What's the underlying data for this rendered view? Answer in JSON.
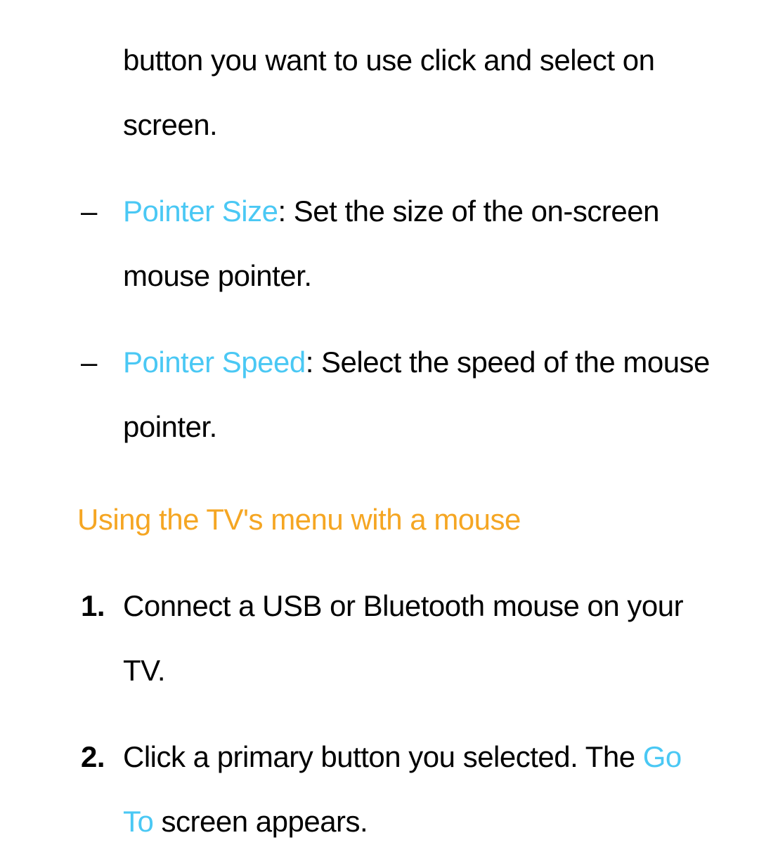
{
  "continuation_text": "button you want to use click and select on screen.",
  "bullets": [
    {
      "marker": "–",
      "label": "Pointer Size",
      "desc": ": Set the size of the on-screen mouse pointer."
    },
    {
      "marker": "–",
      "label": "Pointer Speed",
      "desc": ": Select the speed of the mouse pointer."
    }
  ],
  "heading": "Using the TV's menu with a mouse",
  "steps": [
    {
      "num": "1.",
      "text_before": "Connect a USB or Bluetooth mouse on your TV.",
      "hl": "",
      "text_after": ""
    },
    {
      "num": "2.",
      "text_before": "Click a primary button you selected. The ",
      "hl": "Go To",
      "text_after": " screen appears."
    }
  ]
}
